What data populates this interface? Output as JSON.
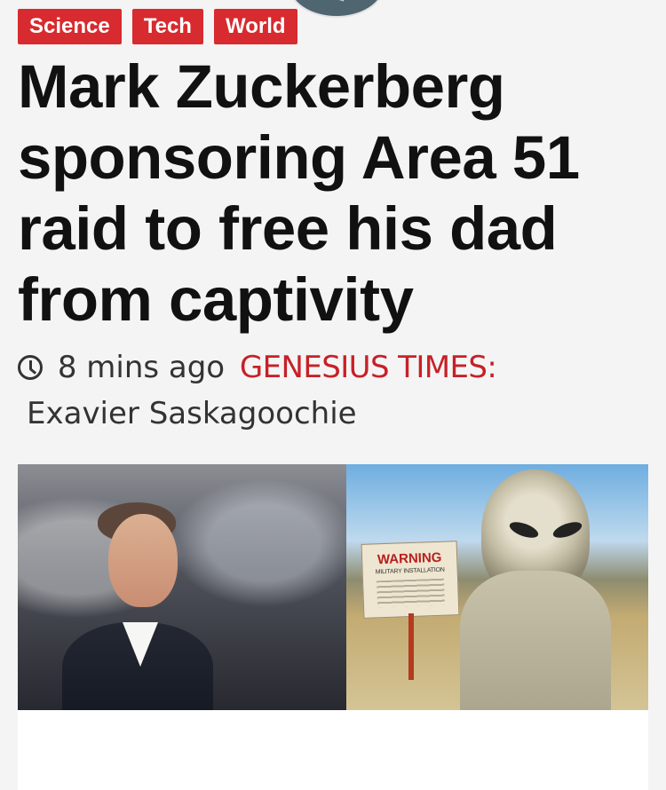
{
  "tags": [
    "Science",
    "Tech",
    "World"
  ],
  "headline": "Mark Zuckerberg sponsoring Area 51 raid to free his dad from captivity",
  "meta": {
    "time": "8 mins ago",
    "source": "GENESIUS TIMES:",
    "author": "Exavier Saskagoochie"
  },
  "image": {
    "sign_title": "WARNING",
    "sign_subtitle": "MILITARY INSTALLATION"
  }
}
